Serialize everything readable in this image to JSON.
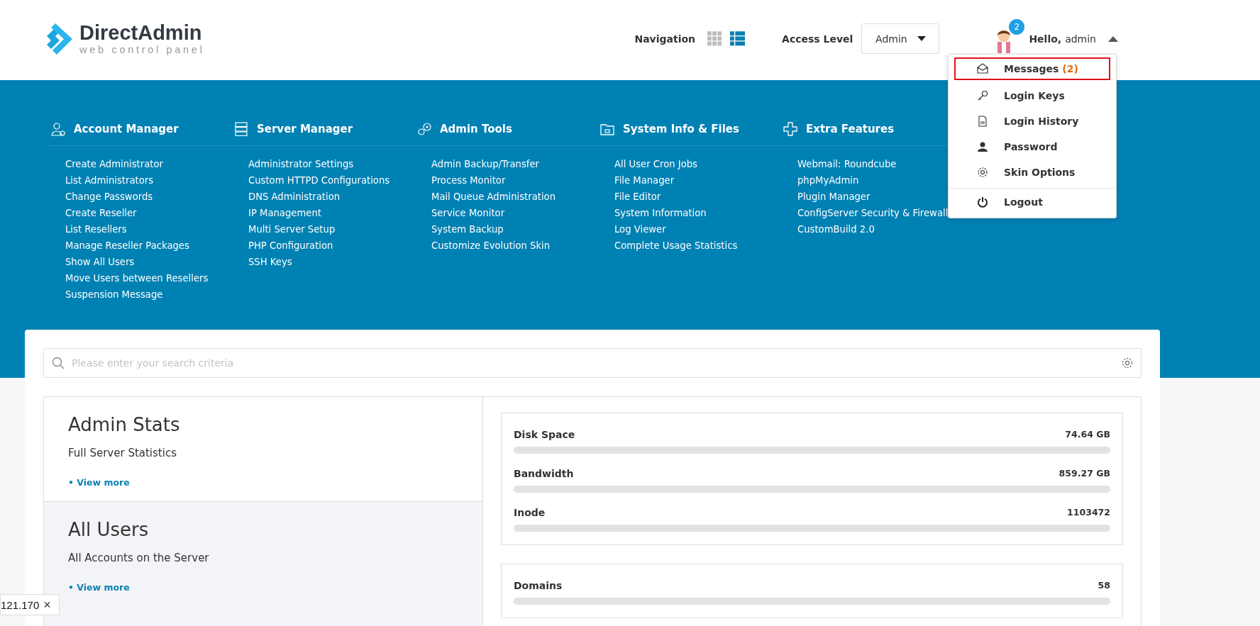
{
  "logo": {
    "name": "DirectAdmin",
    "tagline": "web control panel"
  },
  "header": {
    "navigation_label": "Navigation",
    "navigation_views": [
      {
        "kind": "grid",
        "selected": false
      },
      {
        "kind": "list",
        "selected": true
      }
    ],
    "access_level_label": "Access Level",
    "access_level_value": "Admin",
    "notification_count": "2",
    "greeting": "Hello,",
    "username": "admin",
    "menu_expanded": true
  },
  "user_menu": [
    {
      "kind": "envelope",
      "label": "Messages",
      "count": "(2)",
      "highlighted": true
    },
    {
      "kind": "key",
      "label": "Login Keys",
      "highlighted": false
    },
    {
      "kind": "log",
      "label": "Login History",
      "highlighted": false
    },
    {
      "kind": "person",
      "label": "Password",
      "highlighted": false
    },
    {
      "kind": "gear",
      "label": "Skin Options",
      "highlighted": false
    },
    {
      "kind": "power",
      "label": "Logout",
      "highlighted": false,
      "separated": true
    }
  ],
  "nav_sections": [
    {
      "kind": "users",
      "title": "Account Manager",
      "links": [
        "Create Administrator",
        "List Administrators",
        "Change Passwords",
        "Create Reseller",
        "List Resellers",
        "Manage Reseller Packages",
        "Show All Users",
        "Move Users between Resellers",
        "Suspension Message"
      ]
    },
    {
      "kind": "server",
      "title": "Server Manager",
      "links": [
        "Administrator Settings",
        "Custom HTTPD Configurations",
        "DNS Administration",
        "IP Management",
        "Multi Server Setup",
        "PHP Configuration",
        "SSH Keys"
      ]
    },
    {
      "kind": "gears",
      "title": "Admin Tools",
      "links": [
        "Admin Backup/Transfer",
        "Process Monitor",
        "Mail Queue Administration",
        "Service Monitor",
        "System Backup",
        "Customize Evolution Skin"
      ]
    },
    {
      "kind": "folder",
      "title": "System Info & Files",
      "links": [
        "All User Cron Jobs",
        "File Manager",
        "File Editor",
        "System Information",
        "Log Viewer",
        "Complete Usage Statistics"
      ]
    },
    {
      "kind": "plus",
      "title": "Extra Features",
      "links": [
        "Webmail: Roundcube",
        "phpMyAdmin",
        "Plugin Manager",
        "ConfigServer Security & Firewall",
        "CustomBuild 2.0"
      ]
    }
  ],
  "search": {
    "placeholder": "Please enter your search criteria"
  },
  "stat_panels": [
    {
      "title": "Admin Stats",
      "subtitle": "Full Server Statistics",
      "link": "• View more",
      "selected": false
    },
    {
      "title": "All Users",
      "subtitle": "All Accounts on the Server",
      "link": "• View more",
      "selected": true
    }
  ],
  "usage_cards": [
    [
      {
        "name": "Disk Space",
        "reading": "74.64 GB",
        "level": 0
      },
      {
        "name": "Bandwidth",
        "reading": "859.27 GB",
        "level": 0
      },
      {
        "name": "Inode",
        "reading": "1103472",
        "level": 0
      }
    ],
    [
      {
        "name": "Domains",
        "reading": "58",
        "level": 0
      }
    ]
  ],
  "overlay_chip": {
    "text": "121.170",
    "close": "×"
  }
}
